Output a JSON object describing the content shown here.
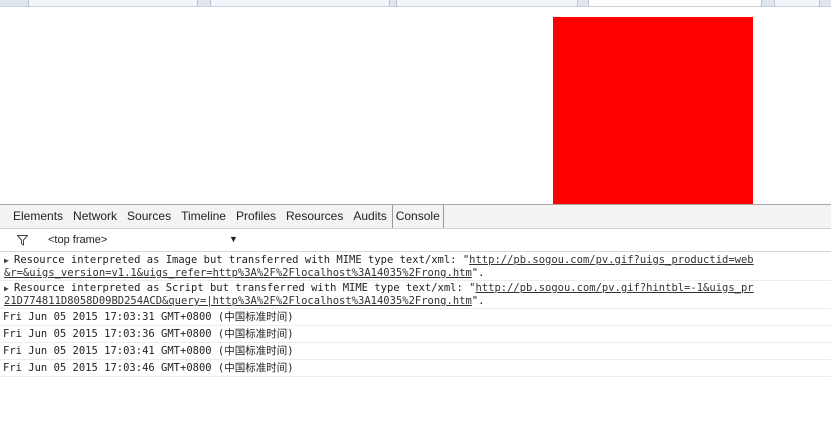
{
  "devtools": {
    "tabs": [
      "Elements",
      "Network",
      "Sources",
      "Timeline",
      "Profiles",
      "Resources",
      "Audits",
      "Console"
    ],
    "active_tab": "Console",
    "frame_selector": "<top frame>"
  },
  "console": {
    "warnings": [
      {
        "line1_prefix": "Resource interpreted as Image but transferred with MIME type text/xml: \"",
        "line1_link": "http://pb.sogou.com/pv.gif?uigs_productid=web",
        "line2_link": "&r=&uigs_version=v1.1&uigs_refer=http%3A%2F%2Flocalhost%3A14035%2Frong.htm",
        "line2_suffix": "\"."
      },
      {
        "line1_prefix": "Resource interpreted as Script but transferred with MIME type text/xml: \"",
        "line1_link": "http://pb.sogou.com/pv.gif?hintbl=-1&uigs_pr",
        "line2_link": "21D774811D8058D09BD254ACD&query=|http%3A%2F%2Flocalhost%3A14035%2Frong.htm",
        "line2_suffix": "\"."
      }
    ],
    "logs": [
      "Fri Jun 05 2015 17:03:31 GMT+0800 (中国标准时间)",
      "Fri Jun 05 2015 17:03:36 GMT+0800 (中国标准时间)",
      "Fri Jun 05 2015 17:03:41 GMT+0800 (中国标准时间)",
      "Fri Jun 05 2015 17:03:46 GMT+0800 (中国标准时间)"
    ]
  },
  "colors": {
    "box": "#ff0000"
  }
}
